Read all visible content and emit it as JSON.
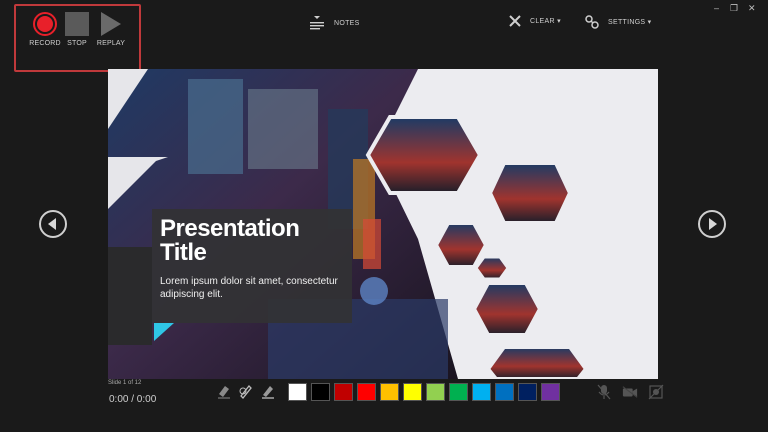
{
  "toolbar": {
    "record_label": "RECORD",
    "stop_label": "STOP",
    "replay_label": "REPLAY",
    "notes_label": "NOTES",
    "clear_label": "CLEAR ▾",
    "settings_label": "SETTINGS ▾"
  },
  "window": {
    "minimize": "–",
    "restore": "❐",
    "close": "✕"
  },
  "slide": {
    "title": "Presentation Title",
    "subtitle": "Lorem ipsum dolor sit amet, consectetur adipiscing elit."
  },
  "status": {
    "slide_counter": "Slide 1 of 12",
    "time": "0:00 / 0:00"
  },
  "colors": {
    "record": "#e8202a",
    "highlight_border": "#c0393b",
    "palette": [
      "#ffffff",
      "#000000",
      "#c00000",
      "#ff0000",
      "#ffc000",
      "#ffff00",
      "#92d050",
      "#00b050",
      "#00b0f0",
      "#0070c0",
      "#002060",
      "#7030a0"
    ]
  },
  "icons": [
    "record-icon",
    "stop-icon",
    "replay-icon",
    "notes-icon",
    "clear-icon",
    "settings-icon",
    "prev-slide-icon",
    "next-slide-icon",
    "eraser-icon",
    "pen-icon",
    "highlighter-icon",
    "microphone-icon",
    "camera-icon",
    "camera-preview-icon"
  ]
}
